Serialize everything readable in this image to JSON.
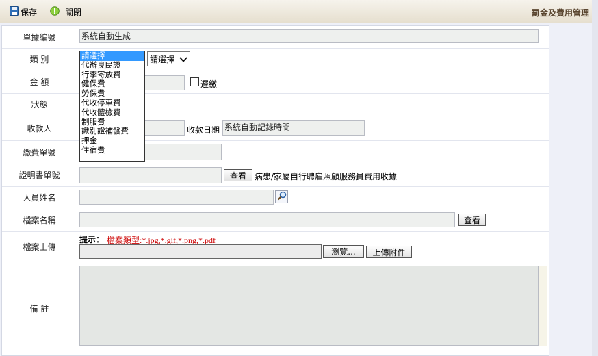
{
  "toolbar": {
    "save_label": "保存",
    "close_label": "關閉",
    "title": "罰金及費用管理"
  },
  "form": {
    "doc_no": {
      "label": "單據編號",
      "value": "系統自動生成"
    },
    "category": {
      "label": "類 別",
      "options": [
        "請選擇",
        "代辦良民證",
        "行李寄放費",
        "健保費",
        "勞保費",
        "代收停車費",
        "代收體檢費",
        "制服費",
        "識別證補發費",
        "押金",
        "住宿費"
      ],
      "selected_index": 0,
      "sub_select": "請選擇"
    },
    "amount": {
      "label": "金 額",
      "value": "",
      "late_label": "遲繳"
    },
    "status": {
      "label": "狀態"
    },
    "payee": {
      "label": "收款人",
      "value": "",
      "date_label": "收款日期",
      "date_value": "系統自動記錄時間"
    },
    "payment_no": {
      "label": "繳費單號",
      "value": ""
    },
    "cert_no": {
      "label": "證明書單號",
      "value": "",
      "view_button": "查看",
      "note": "病患/家屬自行聘雇照顧服務員費用收據"
    },
    "person_name": {
      "label": "人員姓名",
      "value": ""
    },
    "file_name": {
      "label": "檔案名稱",
      "value": "",
      "view_button": "查看"
    },
    "file_upload": {
      "label": "檔案上傳",
      "hint_label": "提示：",
      "hint_types": "檔案類型:*.jpg,*.gif,*.png,*.pdf",
      "browse_button": "瀏覽...",
      "upload_button": "上傳附件"
    },
    "remark": {
      "label": "備 註",
      "value": ""
    }
  },
  "colors": {
    "hint_red": "#cc0000",
    "selected_option": "#3399ff",
    "field_bg": "#eef0ee"
  },
  "icons": [
    "save-icon",
    "close-icon",
    "magnifier-icon",
    "chevron-down-icon"
  ]
}
